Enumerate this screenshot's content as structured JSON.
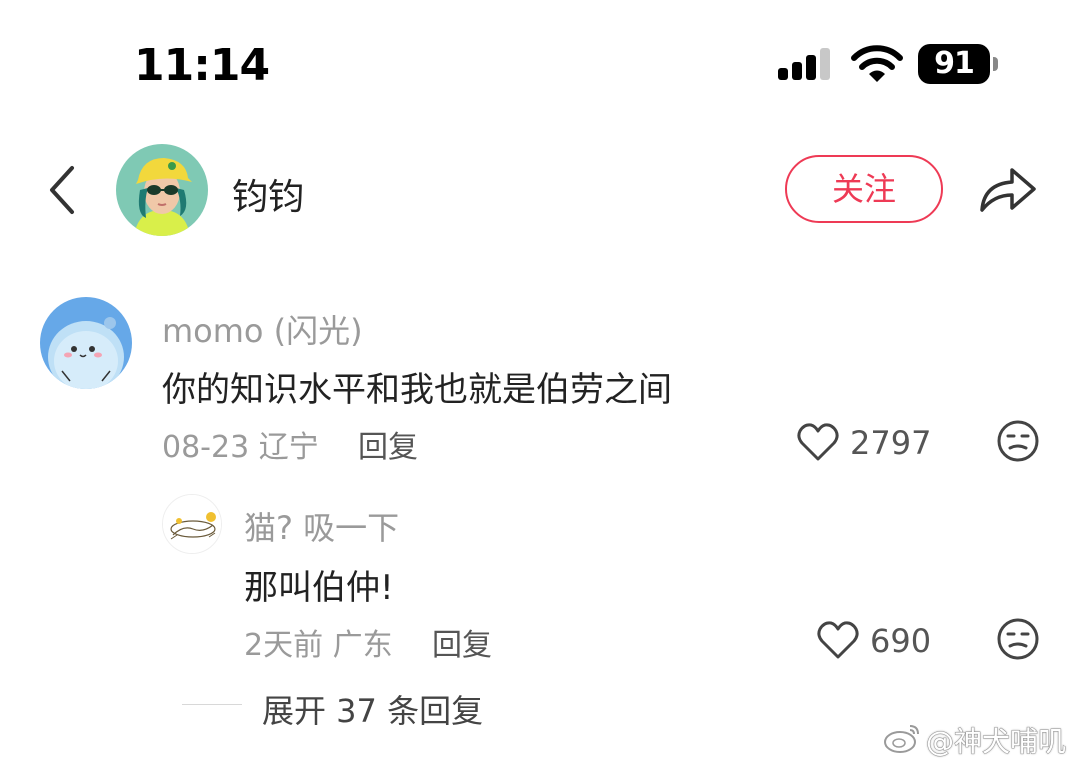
{
  "status_bar": {
    "time": "11:14",
    "battery": "91"
  },
  "header": {
    "back_icon": "chevron-left-icon",
    "name": "钧钧",
    "follow_label": "关注",
    "share_icon": "share-arrow-icon"
  },
  "comments": [
    {
      "author": "momo (闪光)",
      "text": "你的知识水平和我也就是伯劳之间",
      "meta": "08-23 辽宁",
      "reply_label": "回复",
      "likes": "2797",
      "avatar_icon": "blue-mascot-avatar"
    },
    {
      "author": "猫? 吸一下",
      "text": "那叫伯仲!",
      "meta": "2天前 广东",
      "reply_label": "回复",
      "likes": "690",
      "avatar_icon": "cat-sketch-avatar"
    }
  ],
  "expand_replies": "展开 37 条回复",
  "watermark": "@神犬哺叽",
  "colors": {
    "accent": "#ee3a55",
    "muted": "#9a9a9a"
  }
}
